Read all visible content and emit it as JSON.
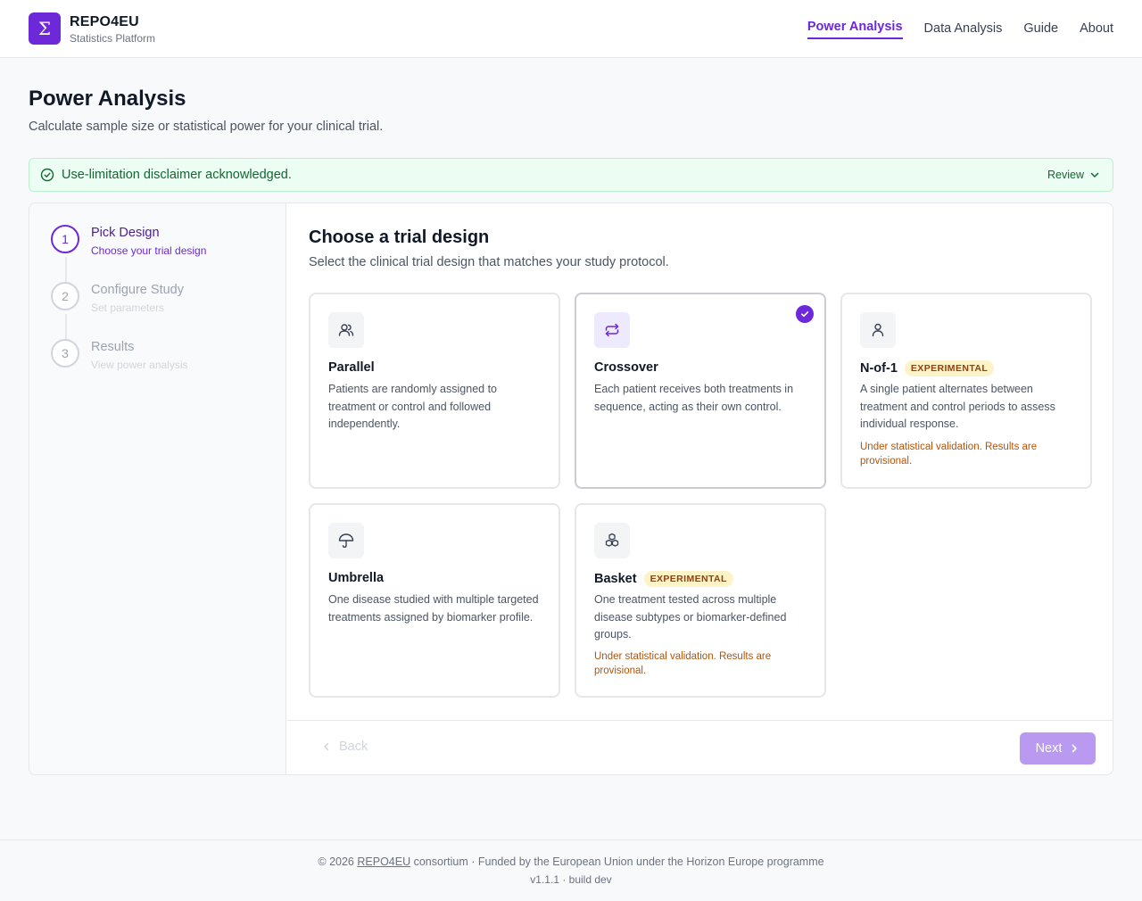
{
  "brand": {
    "name": "REPO4EU",
    "subtitle": "Statistics Platform",
    "logo_icon": "sigma-icon"
  },
  "nav": {
    "items": [
      {
        "label": "Power Analysis",
        "active": true
      },
      {
        "label": "Data Analysis",
        "active": false
      },
      {
        "label": "Guide",
        "active": false
      },
      {
        "label": "About",
        "active": false
      }
    ]
  },
  "page": {
    "title": "Power Analysis",
    "subtitle": "Calculate sample size or statistical power for your clinical trial."
  },
  "banner": {
    "text": "Use-limitation disclaimer acknowledged.",
    "review_label": "Review",
    "icon": "check-circle-icon",
    "color": "#166534"
  },
  "stepper": {
    "steps": [
      {
        "number": "1",
        "title": "Pick Design",
        "subtitle": "Choose your trial design",
        "active": true
      },
      {
        "number": "2",
        "title": "Configure Study",
        "subtitle": "Set parameters",
        "active": false
      },
      {
        "number": "3",
        "title": "Results",
        "subtitle": "View power analysis",
        "active": false
      }
    ]
  },
  "content": {
    "title": "Choose a trial design",
    "subtitle": "Select the clinical trial design that matches your study protocol."
  },
  "designs": [
    {
      "title": "Parallel",
      "description": "Patients are randomly assigned to treatment or control and followed independently.",
      "icon": "users-icon",
      "selected": false
    },
    {
      "title": "Crossover",
      "description": "Each patient receives both treatments in sequence, acting as their own control.",
      "icon": "repeat-icon",
      "selected": true
    },
    {
      "title": "N-of-1",
      "badge": "EXPERIMENTAL",
      "description": "A single patient alternates between treatment and control periods to assess individual response.",
      "warning": "Under statistical validation. Results are provisional.",
      "icon": "user-icon",
      "selected": false
    },
    {
      "title": "Umbrella",
      "description": "One disease studied with multiple targeted treatments assigned by biomarker profile.",
      "icon": "umbrella-icon",
      "selected": false
    },
    {
      "title": "Basket",
      "badge": "EXPERIMENTAL",
      "description": "One treatment tested across multiple disease subtypes or biomarker-defined groups.",
      "warning": "Under statistical validation. Results are provisional.",
      "icon": "boxes-icon",
      "selected": false
    }
  ],
  "actions": {
    "back_label": "Back",
    "next_label": "Next"
  },
  "footer": {
    "copyright_prefix": "© 2026",
    "org_link": "REPO4EU",
    "copyright_suffix": "consortium · Funded by the European Union under the Horizon Europe programme",
    "version": "v1.1.1 · build dev"
  },
  "colors": {
    "accent": "#6d28d9",
    "warning": "#b45309",
    "badge_bg": "#fef3c7"
  }
}
